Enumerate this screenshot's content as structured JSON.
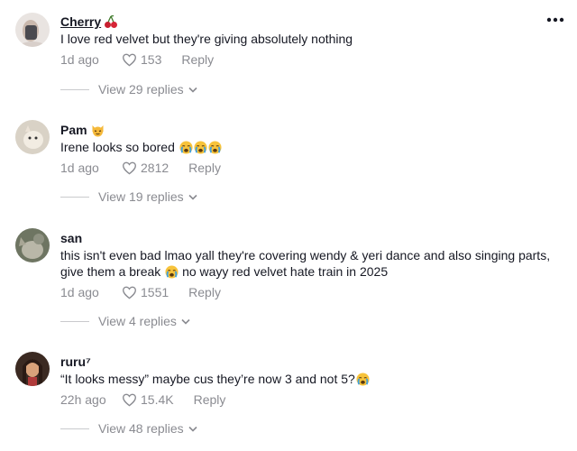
{
  "header": {
    "more_icon": "more-horizontal-icon"
  },
  "comments": [
    {
      "username": "Cherry",
      "badge_icon": "cherries-icon",
      "text": "I love red velvet but they're giving absolutely nothing",
      "time": "1d ago",
      "likes": "153",
      "reply_label": "Reply",
      "view_replies": "View 29 replies"
    },
    {
      "username": "Pam",
      "badge_icon": "cat-face-icon",
      "text": "Irene looks so bored",
      "text_emojis": [
        "crying-face-icon",
        "crying-face-icon",
        "crying-face-icon"
      ],
      "time": "1d ago",
      "likes": "2812",
      "reply_label": "Reply",
      "view_replies": "View 19 replies"
    },
    {
      "username": "san",
      "text_line1": "this isn't even bad lmao yall they're covering wendy & yeri dance and also singing parts,",
      "text_line2a": "give them a break",
      "text_line2b": "no wayy red velvet hate train in 2025",
      "text_emojis": [
        "crying-face-icon"
      ],
      "time": "1d ago",
      "likes": "1551",
      "reply_label": "Reply",
      "view_replies": "View 4 replies"
    },
    {
      "username": "ruru⁷",
      "text": "“It looks messy” maybe cus they’re now 3 and not 5?",
      "text_emojis": [
        "crying-face-icon"
      ],
      "time": "22h ago",
      "likes": "15.4K",
      "reply_label": "Reply",
      "view_replies": "View 48 replies"
    }
  ],
  "colors": {
    "text": "#161823",
    "muted": "#8a8b91",
    "divider": "#c9cacd"
  }
}
